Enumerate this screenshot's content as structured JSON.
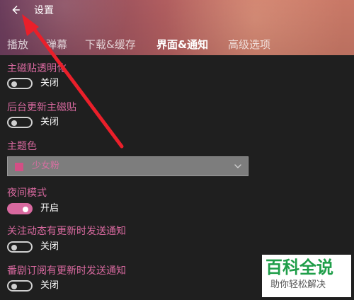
{
  "window": {
    "title": "设置"
  },
  "icons": {
    "back": "arrow-left-icon",
    "chevron": "chevron-down-icon"
  },
  "tabs": [
    {
      "label": "播放",
      "active": false
    },
    {
      "label": "弹幕",
      "active": false
    },
    {
      "label": "下载&缓存",
      "active": false
    },
    {
      "label": "界面&通知",
      "active": true
    },
    {
      "label": "高级选项",
      "active": false
    }
  ],
  "settings": {
    "tile_transparency": {
      "label": "主磁贴透明化",
      "state": "关闭",
      "enabled": false
    },
    "background_tile_update": {
      "label": "后台更新主磁贴",
      "state": "关闭",
      "enabled": false
    },
    "theme_color": {
      "label": "主题色",
      "value": "少女粉",
      "swatch": "#d34f85"
    },
    "night_mode": {
      "label": "夜间模式",
      "state": "开启",
      "enabled": true
    },
    "followed_updates_notify": {
      "label": "关注动态有更新时发送通知",
      "state": "关闭",
      "enabled": false
    },
    "subscribed_drama_notify": {
      "label": "番剧订阅有更新时发送通知",
      "state": "关闭",
      "enabled": false
    }
  },
  "watermark": {
    "title": "百科全说",
    "subtitle": "助你轻松解决"
  },
  "colors": {
    "accent_pink": "#d8699f",
    "arrow_red": "#ea1f2a",
    "watermark_green": "#1f9e49",
    "background": "#1f1f1f"
  }
}
